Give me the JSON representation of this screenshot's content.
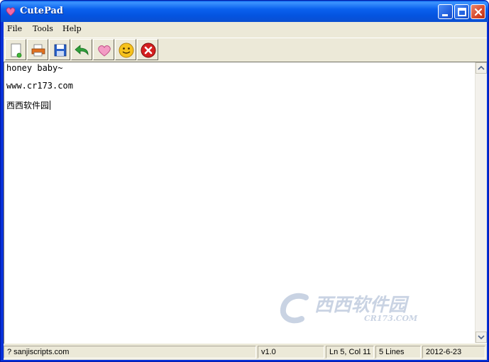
{
  "window": {
    "title": "CutePad",
    "icon": "heart-icon"
  },
  "menu": {
    "items": [
      {
        "label": "File"
      },
      {
        "label": "Tools"
      },
      {
        "label": "Help"
      }
    ]
  },
  "toolbar": {
    "buttons": [
      {
        "icon": "new-document-icon"
      },
      {
        "icon": "print-icon"
      },
      {
        "icon": "save-icon"
      },
      {
        "icon": "undo-arrow-icon"
      },
      {
        "icon": "heart-icon"
      },
      {
        "icon": "smiley-icon"
      },
      {
        "icon": "exit-icon"
      }
    ]
  },
  "editor": {
    "lines": [
      "honey baby~",
      "www.cr173.com",
      "西西软件园"
    ]
  },
  "watermark": {
    "main": "西西软件园",
    "sub": "CR173.COM"
  },
  "status": {
    "website": "? sanjiscripts.com",
    "version": "v1.0",
    "position": "Ln 5, Col 11",
    "lines": "5 Lines",
    "date": "2012-6-23"
  },
  "colors": {
    "titlebar": "#0a61ee",
    "close_button": "#d7482a",
    "chrome": "#ece9d8"
  }
}
